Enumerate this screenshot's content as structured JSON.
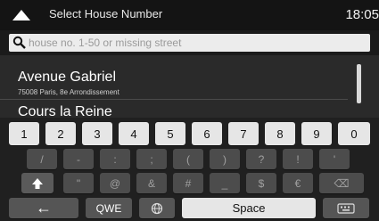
{
  "status": {
    "title": "Select House Number",
    "time": "18:05"
  },
  "search": {
    "placeholder": "house no. 1-50 or missing street"
  },
  "results": [
    {
      "name": "Avenue Gabriel",
      "sub": "75008 Paris, 8e Arrondissement"
    },
    {
      "name": "Cours la Reine",
      "sub": ""
    }
  ],
  "keyboard": {
    "digits": [
      "1",
      "2",
      "3",
      "4",
      "5",
      "6",
      "7",
      "8",
      "9",
      "0"
    ],
    "symbols": [
      "/",
      "-",
      ":",
      ";",
      "(",
      ")",
      "?",
      "!",
      "'"
    ],
    "row3": [
      "\"",
      "@",
      "&",
      "#",
      "_",
      "$",
      "€",
      "⌫"
    ],
    "bottom": {
      "back": "←",
      "layout": "QWE",
      "space": "Space"
    }
  }
}
